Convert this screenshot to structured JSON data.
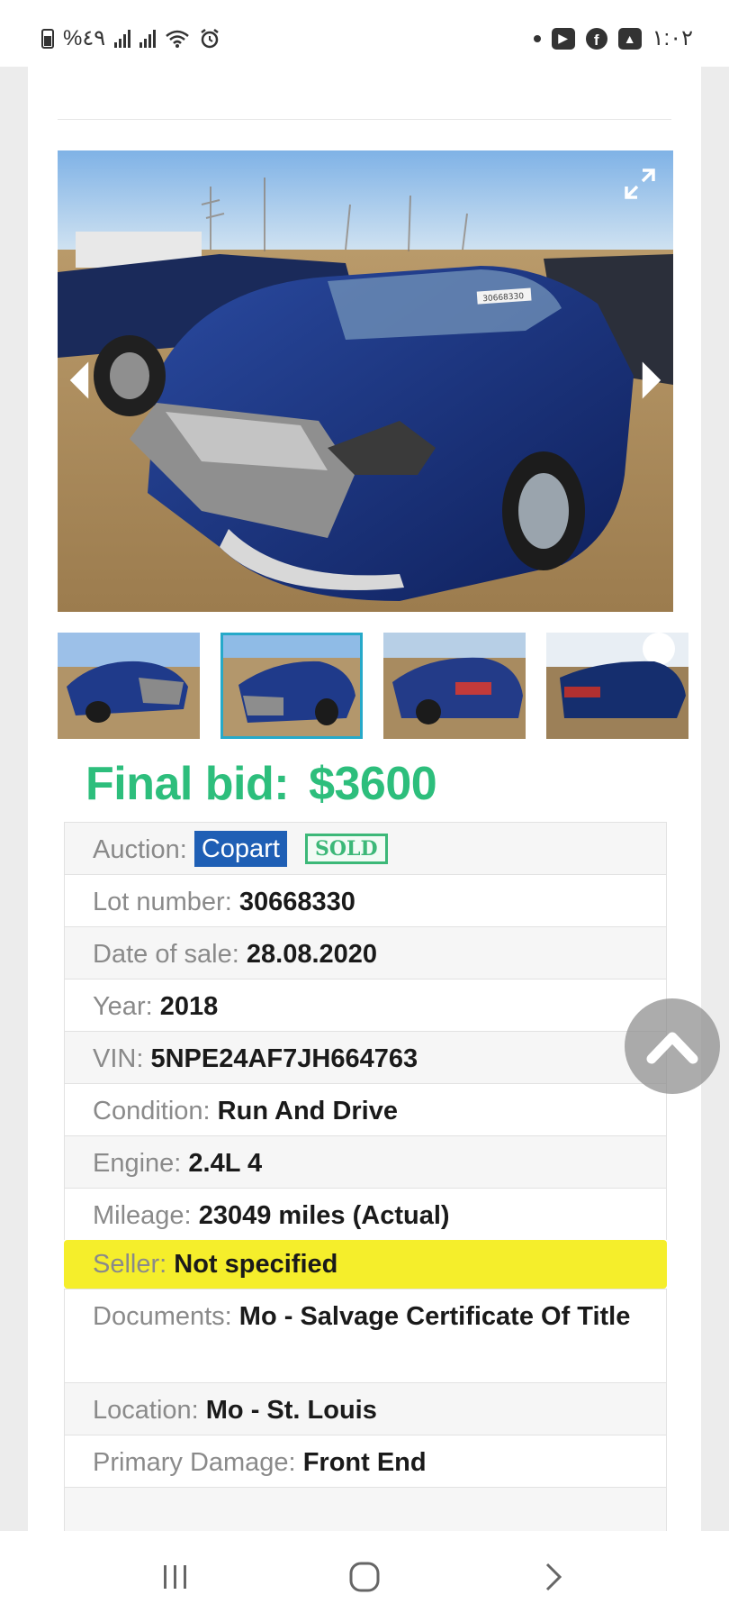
{
  "status_bar": {
    "battery_text": "%٤٩",
    "time": "١:٠٢"
  },
  "final_bid": {
    "label": "Final bid:",
    "amount": "$3600"
  },
  "auction": {
    "label": "Auction:",
    "value": "Copart",
    "status_badge": "SOLD"
  },
  "details": [
    {
      "label": "Lot number:",
      "value": "30668330"
    },
    {
      "label": "Date of sale:",
      "value": "28.08.2020"
    },
    {
      "label": "Year:",
      "value": "2018"
    },
    {
      "label": "VIN:",
      "value": "5NPE24AF7JH664763"
    },
    {
      "label": "Condition:",
      "value": "Run And Drive"
    },
    {
      "label": "Engine:",
      "value": "2.4L 4"
    },
    {
      "label": "Mileage:",
      "value": "23049 miles (Actual)"
    },
    {
      "label": "Seller:",
      "value": "Not specified"
    },
    {
      "label": "Documents:",
      "value": "Mo - Salvage Certificate Of Title"
    },
    {
      "label": "Location:",
      "value": "Mo - St. Louis"
    },
    {
      "label": "Primary Damage:",
      "value": "Front End"
    }
  ],
  "photo": {
    "lot_sticker": "30668330"
  },
  "colors": {
    "final_bid": "#2dbe7c",
    "copart_badge": "#1f5fb5",
    "sold_badge": "#3cb878",
    "highlight": "#f5ee2b",
    "active_thumb_border": "#26a9c9"
  },
  "icons": {
    "prev": "chevron-left-icon",
    "next": "chevron-right-icon",
    "expand": "expand-icon",
    "scroll_top": "chevron-up-icon",
    "nav_recents": "recent-apps-icon",
    "nav_home": "home-icon",
    "nav_back": "back-icon"
  }
}
